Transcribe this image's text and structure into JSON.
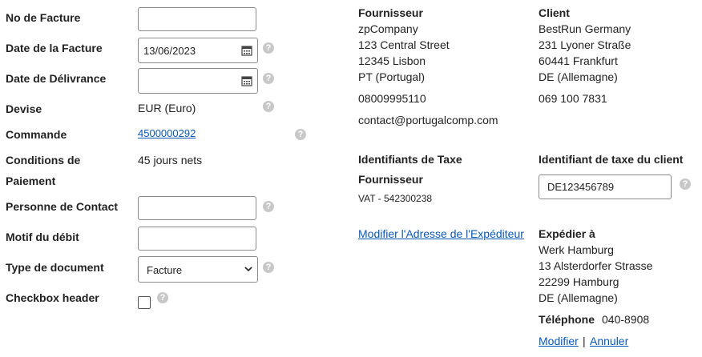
{
  "left_form": {
    "invoice_no_label": "No de Facture",
    "invoice_no_value": "",
    "invoice_date_label": "Date de la Facture",
    "invoice_date_value": "13/06/2023",
    "delivery_date_label": "Date de Délivrance",
    "delivery_date_value": "",
    "currency_label": "Devise",
    "currency_value": "EUR (Euro)",
    "order_label": "Commande",
    "order_value": "4500000292",
    "payment_terms_label_1": "Conditions de",
    "payment_terms_label_2": "Paiement",
    "payment_terms_value": "45 jours nets",
    "contact_label": "Personne de Contact",
    "contact_value": "",
    "debit_reason_label": "Motif du débit",
    "debit_reason_value": "",
    "doc_type_label": "Type de document",
    "doc_type_value": "Facture",
    "checkbox_label": "Checkbox header",
    "help_glyph": "?"
  },
  "supplier": {
    "heading": "Fournisseur",
    "name": "zpCompany",
    "street": "123 Central Street",
    "city": "12345 Lisbon",
    "country": "PT (Portugal)",
    "phone": "08009995110",
    "email": "contact@portugalcomp.com"
  },
  "client": {
    "heading": "Client",
    "name": "BestRun Germany",
    "street": "231 Lyoner Straße",
    "city": "60441 Frankfurt",
    "country": "DE (Allemagne)",
    "phone": "069 100 7831"
  },
  "tax": {
    "heading": "Identifiants de Taxe",
    "supplier_sub": "Fournisseur",
    "supplier_vat": "VAT - 542300238",
    "client_heading": "Identifiant de taxe du client",
    "client_value": "DE123456789"
  },
  "shipper_link": "Modifier l'Adresse de l'Expéditeur",
  "ship_to": {
    "heading": "Expédier à",
    "name": "Werk Hamburg",
    "street": "13 Alsterdorfer Strasse",
    "city": "22299 Hamburg",
    "country": "DE (Allemagne)",
    "phone_label": "Téléphone",
    "phone_value": "040-8908",
    "modify": "Modifier",
    "separator": "|",
    "cancel": "Annuler"
  }
}
